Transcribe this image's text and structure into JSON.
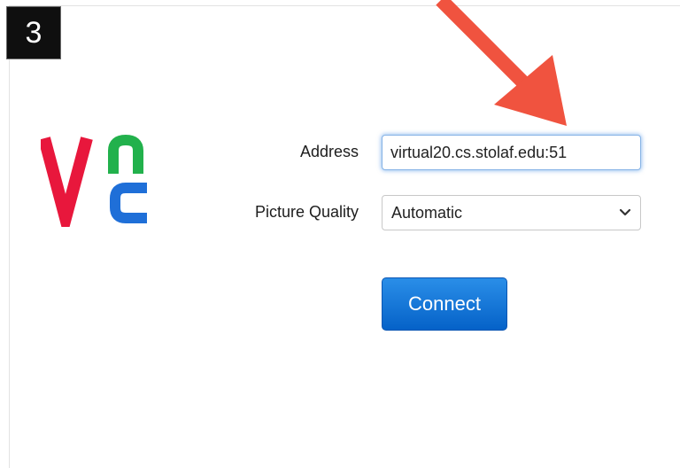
{
  "step": {
    "number": "3"
  },
  "form": {
    "address_label": "Address",
    "address_value": "virtual20.cs.stolaf.edu:51",
    "quality_label": "Picture Quality",
    "quality_selected": "Automatic",
    "connect_label": "Connect"
  },
  "logo": {
    "name": "vnc-logo",
    "colors": {
      "v": "#e8173c",
      "n": "#22b14c",
      "c": "#1f6fd8"
    }
  },
  "colors": {
    "annotation_arrow": "#f0533f",
    "primary_button": "#0b6fd6",
    "focus_ring": "#5c9ded"
  },
  "icons": {
    "dropdown": "chevron-down-icon"
  }
}
